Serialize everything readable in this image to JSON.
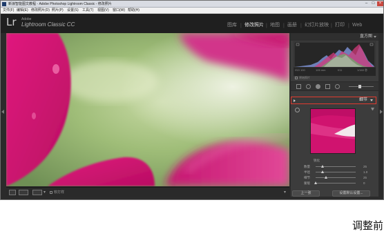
{
  "window": {
    "title": "新浪智能图文教程 - Adobe Photoshop Lightroom Classic - 修改照片",
    "controls": [
      "minimize",
      "maximize",
      "close"
    ]
  },
  "menu": [
    "文件(F)",
    "编辑(E)",
    "修改照片(D)",
    "照片(P)",
    "设置(S)",
    "工具(T)",
    "视图(V)",
    "窗口(W)",
    "帮助(H)"
  ],
  "identity": {
    "logo": "Lr",
    "line1": "Adobe",
    "line2": "Lightroom Classic CC"
  },
  "modules": [
    "图库",
    "修改照片",
    "地图",
    "画册",
    "幻灯片放映",
    "打印",
    "Web"
  ],
  "active_module": "修改照片",
  "panels": {
    "histogram_title": "直方图",
    "histogram_labels": [
      "ISO 100",
      "105 mm",
      "f/11",
      "1/160 秒"
    ],
    "original_photo": "原始照片",
    "detail_title": "细节"
  },
  "sharpening": {
    "section": "锐化",
    "rows": [
      {
        "label": "数量",
        "value": "25",
        "fraction": 0.17
      },
      {
        "label": "半径",
        "value": "1.0",
        "fraction": 0.18
      },
      {
        "label": "细节",
        "value": "25",
        "fraction": 0.25
      },
      {
        "label": "蒙版",
        "value": "0",
        "fraction": 0.0
      }
    ]
  },
  "toolbar": {
    "view_mode": "",
    "compare_label": "软打样"
  },
  "buttons": {
    "previous": "上一张",
    "reset": "设置默认设置..."
  },
  "colors": {
    "accent_highlight": "#e23b2f",
    "photo_magenta": "#d0136f",
    "photo_green": "#a9c48a"
  },
  "caption": "调整前"
}
